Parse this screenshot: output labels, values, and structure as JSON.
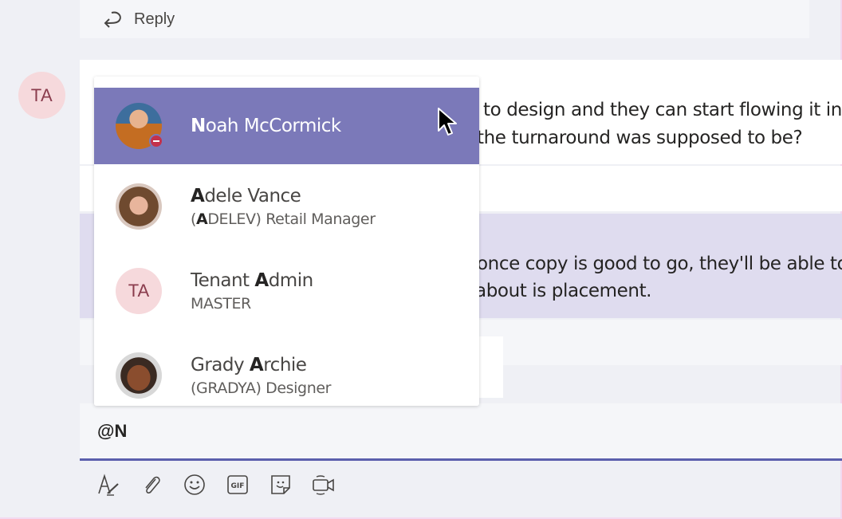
{
  "previous_thread": {
    "reply_label": "Reply"
  },
  "thread": {
    "avatar_initials": "TA",
    "message_1": {
      "line_1": "to design and they can start flowing it into",
      "line_2": "the turnaround was supposed to be?"
    },
    "message_2": {
      "line_1": "once copy is good to go, they'll be able to",
      "line_2": "about is placement."
    }
  },
  "mention_popup": {
    "items": [
      {
        "highlight": "N",
        "name_rest": "oah McCormick",
        "name_prefix": "",
        "subtitle_prefix": "",
        "subtitle_highlight": "",
        "subtitle_rest": "",
        "avatar": "photo",
        "presence": "do-not-disturb",
        "selected": true
      },
      {
        "highlight": "A",
        "name_prefix": "",
        "name_rest": "dele Vance",
        "subtitle_prefix": "(",
        "subtitle_highlight": "A",
        "subtitle_rest": "DELEV) Retail Manager",
        "avatar": "photo",
        "selected": false
      },
      {
        "highlight": "A",
        "name_prefix": "Tenant ",
        "name_rest": "dmin",
        "subtitle_prefix": "",
        "subtitle_highlight": "",
        "subtitle_rest": "MASTER",
        "avatar": "initials",
        "avatar_initials": "TA",
        "selected": false
      },
      {
        "highlight": "A",
        "name_prefix": "Grady ",
        "name_rest": "rchie",
        "subtitle_prefix": "(GRADYA) Designer",
        "subtitle_highlight": "",
        "subtitle_rest": "",
        "avatar": "photo",
        "selected": false
      }
    ]
  },
  "compose": {
    "value": "@N"
  },
  "toolbar": {
    "icons": [
      "format-icon",
      "attach-icon",
      "emoji-icon",
      "gif-icon",
      "sticker-icon",
      "meet-now-icon"
    ]
  },
  "colors": {
    "accent": "#5b5fad",
    "selected_item": "#7b79b9",
    "highlighted_message": "#dfdcef",
    "presence_busy": "#c4314b",
    "avatar_bg": "#f6d9dc",
    "avatar_fg": "#8a3c4d"
  }
}
